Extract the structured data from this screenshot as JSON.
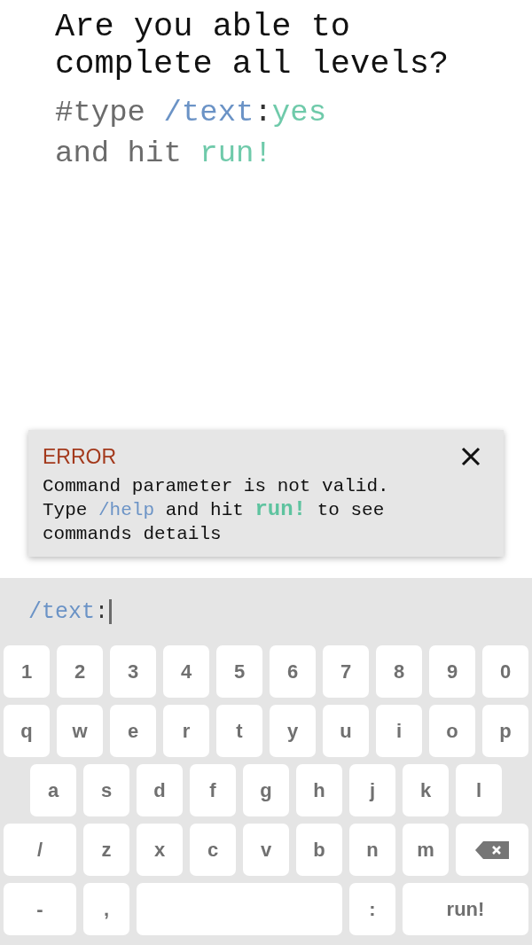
{
  "prompt": {
    "title": "Are you able to complete all levels?",
    "hint_lines": [
      [
        {
          "text": "#type ",
          "kind": "plain"
        },
        {
          "text": "/text",
          "kind": "command"
        },
        {
          "text": ":",
          "kind": "separator"
        },
        {
          "text": "yes",
          "kind": "value"
        }
      ],
      [
        {
          "text": "and hit ",
          "kind": "plain"
        },
        {
          "text": "run!",
          "kind": "action"
        }
      ]
    ]
  },
  "error_card": {
    "heading": "ERROR",
    "message_lines": [
      [
        {
          "text": "Command parameter is not valid.",
          "kind": "plain"
        }
      ],
      [
        {
          "text": "Type ",
          "kind": "plain"
        },
        {
          "text": "/help",
          "kind": "command"
        },
        {
          "text": " and hit ",
          "kind": "plain"
        },
        {
          "text": "run!",
          "kind": "action"
        },
        {
          "text": " to see",
          "kind": "plain"
        }
      ],
      [
        {
          "text": "commands details",
          "kind": "plain"
        }
      ]
    ]
  },
  "command_input": {
    "segments": [
      {
        "text": "/text",
        "kind": "command"
      },
      {
        "text": ":",
        "kind": "separator"
      }
    ],
    "focused": true
  },
  "keyboard": {
    "rows": [
      {
        "kind": "full",
        "keys": [
          {
            "kind": "char",
            "label": "1"
          },
          {
            "kind": "char",
            "label": "2"
          },
          {
            "kind": "char",
            "label": "3"
          },
          {
            "kind": "char",
            "label": "4"
          },
          {
            "kind": "char",
            "label": "5"
          },
          {
            "kind": "char",
            "label": "6"
          },
          {
            "kind": "char",
            "label": "7"
          },
          {
            "kind": "char",
            "label": "8"
          },
          {
            "kind": "char",
            "label": "9"
          },
          {
            "kind": "char",
            "label": "0"
          }
        ]
      },
      {
        "kind": "full",
        "keys": [
          {
            "kind": "char",
            "label": "q"
          },
          {
            "kind": "char",
            "label": "w"
          },
          {
            "kind": "char",
            "label": "e"
          },
          {
            "kind": "char",
            "label": "r"
          },
          {
            "kind": "char",
            "label": "t"
          },
          {
            "kind": "char",
            "label": "y"
          },
          {
            "kind": "char",
            "label": "u"
          },
          {
            "kind": "char",
            "label": "i"
          },
          {
            "kind": "char",
            "label": "o"
          },
          {
            "kind": "char",
            "label": "p"
          }
        ]
      },
      {
        "kind": "indented",
        "keys": [
          {
            "kind": "char",
            "label": "a"
          },
          {
            "kind": "char",
            "label": "s"
          },
          {
            "kind": "char",
            "label": "d"
          },
          {
            "kind": "char",
            "label": "f"
          },
          {
            "kind": "char",
            "label": "g"
          },
          {
            "kind": "char",
            "label": "h"
          },
          {
            "kind": "char",
            "label": "j"
          },
          {
            "kind": "char",
            "label": "k"
          },
          {
            "kind": "char",
            "label": "l"
          }
        ]
      },
      {
        "kind": "full",
        "keys": [
          {
            "kind": "wide",
            "label": "/"
          },
          {
            "kind": "char",
            "label": "z"
          },
          {
            "kind": "char",
            "label": "x"
          },
          {
            "kind": "char",
            "label": "c"
          },
          {
            "kind": "char",
            "label": "v"
          },
          {
            "kind": "char",
            "label": "b"
          },
          {
            "kind": "char",
            "label": "n"
          },
          {
            "kind": "char",
            "label": "m"
          },
          {
            "kind": "backspace"
          }
        ]
      },
      {
        "kind": "full",
        "keys": [
          {
            "kind": "wide",
            "label": "-"
          },
          {
            "kind": "char",
            "label": ","
          },
          {
            "kind": "space"
          },
          {
            "kind": "char",
            "label": ":"
          },
          {
            "kind": "action",
            "label": "run!"
          }
        ]
      }
    ]
  }
}
